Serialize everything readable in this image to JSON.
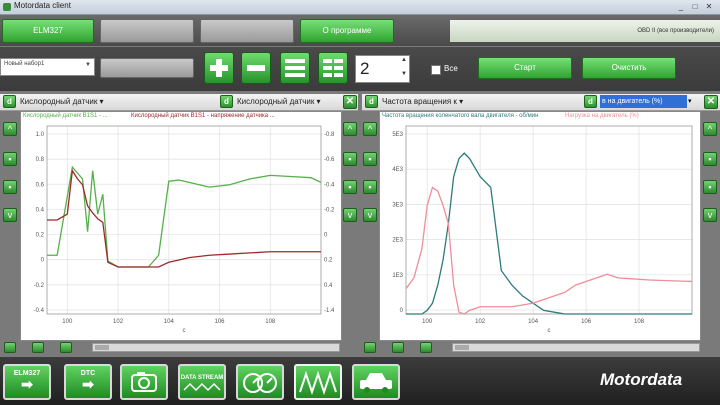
{
  "window": {
    "title": "Motordata client"
  },
  "top_tabs": [
    {
      "label": "ELM327",
      "active": true
    },
    {
      "label": "",
      "active": false
    },
    {
      "label": "",
      "active": false
    },
    {
      "label": "О программе",
      "active": true
    }
  ],
  "status": {
    "text": "OBD II (все производители)"
  },
  "toolbar": {
    "profile_placeholder": "Новый набор1",
    "counter_value": "2",
    "all_label": "Все",
    "start_label": "Старт",
    "clear_label": "Очистить"
  },
  "left_panel": {
    "sensor1": "Кислородный датчик",
    "sensor2": "Кислородный датчик",
    "legend1": "Кислородный датчик B1S1 - ...",
    "legend2": "Кислородный датчик B1S1 - напряжение датчика ...",
    "x_label": "с"
  },
  "right_panel": {
    "sensor1": "Частота вращения к",
    "sensor2": "в на двигатель (%)",
    "legend1": "Частота вращения коленчатого вала двигателя - об/мин",
    "legend2": "Нагрузка на двигатель (%)",
    "x_label": "с"
  },
  "bottom": {
    "buttons": [
      "ELM327",
      "DTC",
      "",
      "DATA STREAM",
      "",
      "",
      ""
    ],
    "brand": "Motordata"
  },
  "colors": {
    "green": "#2fa32f",
    "series_green": "#55b04a",
    "series_dark_red": "#9b2b2b",
    "series_teal": "#2e7b7b",
    "series_pink": "#ee8e98"
  },
  "chart_data": [
    {
      "type": "line",
      "x": [
        99.2,
        99.6,
        100,
        100.2,
        100.4,
        100.6,
        100.8,
        101,
        101.2,
        101.4,
        101.6,
        102,
        102.4,
        102.8,
        103.2,
        103.6,
        104,
        104.4,
        104.8,
        105.6,
        106.4,
        107.2,
        108,
        108.8,
        109.6,
        110
      ],
      "series": [
        {
          "name": "Кислородный датчик B1S1",
          "values": [
            0.1,
            0.1,
            0.6,
            0.85,
            0.8,
            0.75,
            0.3,
            0.82,
            0.45,
            0.62,
            0.05,
            0.0,
            0.0,
            0.0,
            0.0,
            0.1,
            0.73,
            0.74,
            0.72,
            0.68,
            0.7,
            0.75,
            0.78,
            0.77,
            0.76,
            0.72
          ]
        },
        {
          "name": "напряжение датчика",
          "values": [
            0.4,
            0.4,
            0.45,
            0.82,
            0.75,
            0.7,
            0.52,
            0.46,
            0.41,
            0.38,
            0.04,
            0.0,
            0.0,
            0.0,
            0.0,
            0.0,
            0.04,
            0.06,
            0.08,
            0.1,
            0.11,
            0.12,
            0.13,
            0.13,
            0.13,
            0.13
          ]
        }
      ],
      "x_ticks": [
        "100",
        "102",
        "104",
        "106",
        "108"
      ],
      "y_ticks_left": [
        "1.0",
        "0.8",
        "0.6",
        "0.4",
        "0.2",
        "0",
        "-0.2",
        "-0.4"
      ],
      "y_ticks_right": [
        "-0.8",
        "-0.6",
        "-0.4",
        "-0.2",
        "0",
        "0.2",
        "0.4",
        "-1.4"
      ],
      "xlim": [
        99.2,
        110
      ],
      "ylim": [
        -0.4,
        1.2
      ]
    },
    {
      "type": "line",
      "x": [
        99.2,
        99.5,
        99.8,
        100,
        100.2,
        100.4,
        100.6,
        100.8,
        101,
        101.2,
        101.4,
        101.6,
        101.8,
        102,
        102.4,
        102.8,
        103.2,
        103.6,
        104,
        104.4,
        104.8,
        105.2,
        105.6,
        106,
        106.4,
        106.8,
        107.2,
        107.6,
        108,
        108.4,
        108.8,
        109.2,
        109.6,
        110
      ],
      "series": [
        {
          "name": "Частота вращения коленчатого вала двигателя",
          "values": [
            0,
            0,
            0,
            100,
            300,
            800,
            1500,
            2500,
            3800,
            4300,
            4450,
            4300,
            4050,
            3800,
            3500,
            1200,
            800,
            500,
            300,
            100,
            50,
            0,
            0,
            0,
            0,
            0,
            0,
            0,
            0,
            0,
            0,
            0,
            0,
            0
          ]
        },
        {
          "name": "Нагрузка на двигатель",
          "values": [
            700,
            1000,
            1800,
            3000,
            3500,
            3400,
            3000,
            2500,
            800,
            50,
            0,
            100,
            150,
            200,
            200,
            200,
            200,
            250,
            300,
            400,
            500,
            600,
            800,
            900,
            1000,
            1100,
            1000,
            980,
            960,
            940,
            930,
            920,
            910,
            900
          ]
        }
      ],
      "x_ticks": [
        "100",
        "102",
        "104",
        "106",
        "108"
      ],
      "y_ticks_left": [
        "5E3",
        "4E3",
        "3E3",
        "2E3",
        "1E3",
        "0"
      ],
      "xlim": [
        99.2,
        110
      ],
      "ylim": [
        0,
        5200
      ]
    }
  ]
}
